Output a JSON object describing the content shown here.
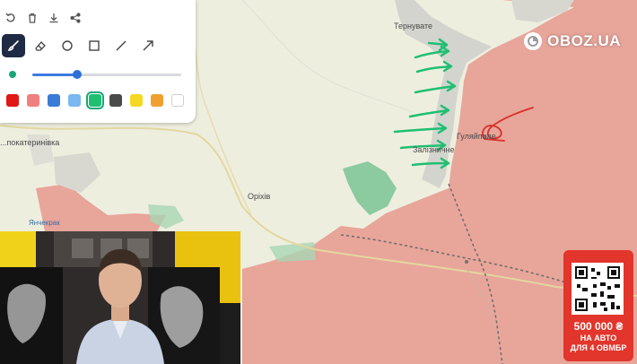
{
  "brand": {
    "name": "OBOZ.UA",
    "icon": "oboz-logo-icon"
  },
  "map": {
    "labels": {
      "ternuvate": "Тернувате",
      "huliaipole": "Гуляйполе",
      "zaliznychne": "Залізничне",
      "orikhiv": "Оріхів",
      "katerynivka": "...покатеринівка",
      "yanchekrak": "Янчекрак"
    },
    "colors": {
      "controlled_territory": "#e8a59a",
      "contested_zone": "#cfd0cb",
      "base_land": "#eeeedf",
      "arrow_green": "#1fbf72",
      "annotation_red": "#d8302a"
    }
  },
  "toolbar": {
    "actions": [
      {
        "name": "undo-icon"
      },
      {
        "name": "delete-icon"
      },
      {
        "name": "download-icon"
      },
      {
        "name": "share-icon"
      }
    ],
    "tools": [
      {
        "name": "brush-icon",
        "active": true
      },
      {
        "name": "eraser-icon",
        "active": false
      },
      {
        "name": "circle-icon",
        "active": false
      },
      {
        "name": "square-icon",
        "active": false
      },
      {
        "name": "line-icon",
        "active": false
      },
      {
        "name": "arrow-icon",
        "active": false
      }
    ],
    "stroke_size_fraction": 0.3,
    "colors": [
      "#e01818",
      "#f08080",
      "#3a7bd5",
      "#79b8f0",
      "#1fbf72",
      "#4a4a4a",
      "#f5d824",
      "#f0a030",
      "#ffffff"
    ],
    "selected_color_index": 4
  },
  "promo": {
    "amount": "500 000 ₴",
    "line2": "НА АВТО",
    "line3": "ДЛЯ 4 ОВМБР"
  }
}
